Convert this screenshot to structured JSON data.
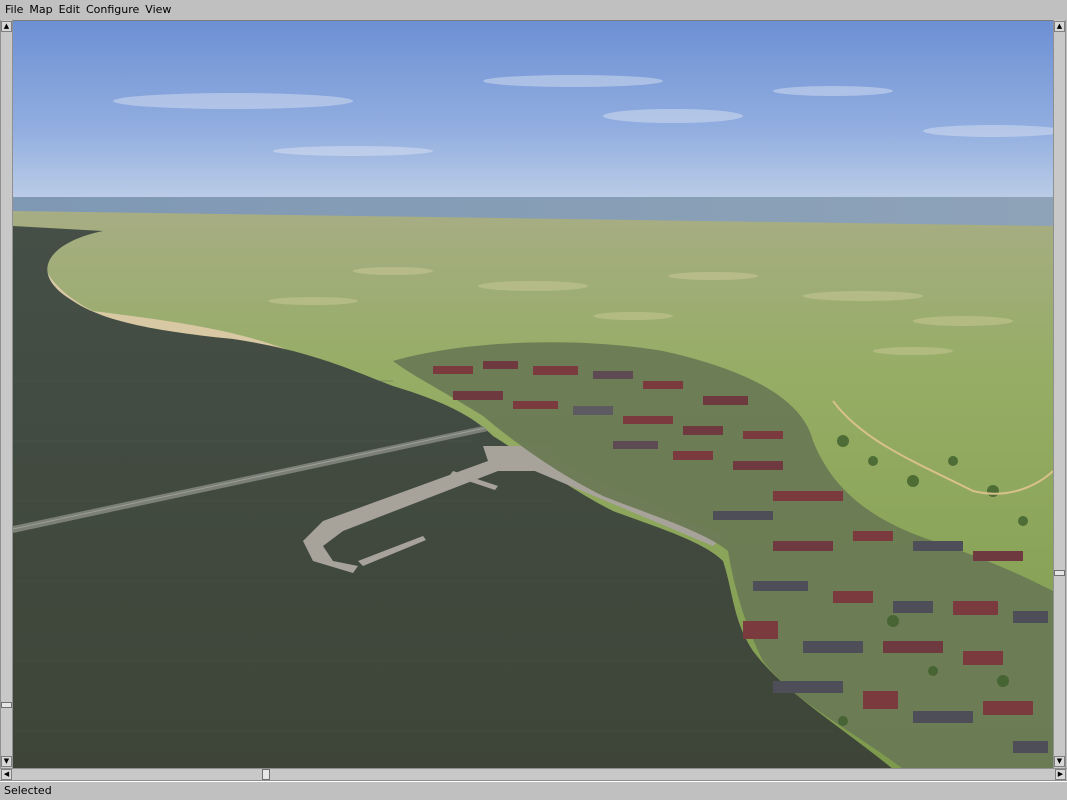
{
  "menu": {
    "items": [
      {
        "label": "File"
      },
      {
        "label": "Map"
      },
      {
        "label": "Edit"
      },
      {
        "label": "Configure"
      },
      {
        "label": "View"
      }
    ]
  },
  "status": {
    "text": "Selected"
  },
  "icons": {
    "scroll_up": "arrow-up-icon",
    "scroll_down": "arrow-down-icon",
    "scroll_left": "arrow-left-icon",
    "scroll_right": "arrow-right-icon"
  },
  "colors": {
    "sky_top": "#6f93d6",
    "sky_horizon": "#b7c9e4",
    "sea": "#3f4a3f",
    "land": "#8aa45a",
    "sand": "#d8c9a4"
  }
}
